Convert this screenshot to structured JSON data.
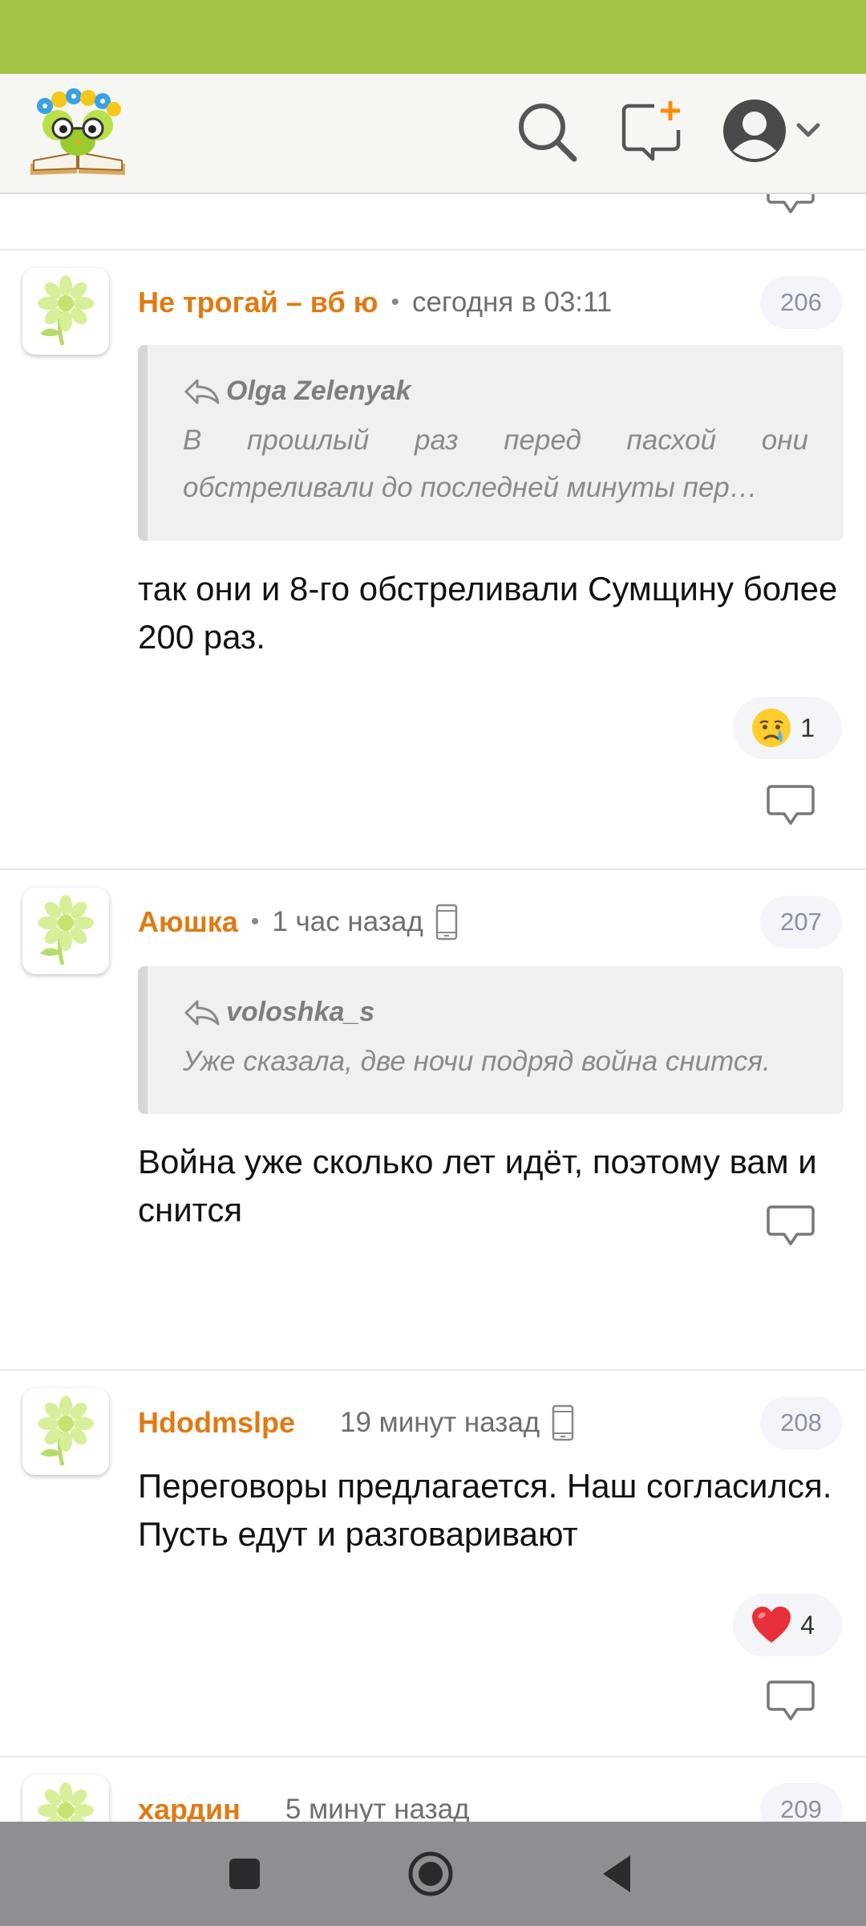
{
  "colors": {
    "status_bar": "#9fc345",
    "author": "#e07a12",
    "accent": "#ff8a00"
  },
  "header": {
    "logo": "book-owl-logo",
    "icons": [
      "search-icon",
      "new-post-icon",
      "profile-avatar-icon",
      "chevron-down-icon"
    ]
  },
  "comments": [
    {
      "author": "Не трогай – вб ю",
      "time": "сегодня в 03:11",
      "number": "206",
      "quote": {
        "author": "Olga Zelenyak",
        "line1": "В прошлый раз перед пасхой они",
        "line2": "обстреливали до последней минуты пер…"
      },
      "text": "так они и 8-го обстреливали Сумщину более 200 раз.",
      "reaction": {
        "icon": "crying-face-emoji",
        "count": "1"
      }
    },
    {
      "author": "Аюшка",
      "time": "1 час назад",
      "number": "207",
      "quote": {
        "author": "voloshka_s",
        "text": "Уже сказала, две ночи подряд война снится."
      },
      "text": "Война уже сколько лет идёт, поэтому вам и снится"
    },
    {
      "author": "Hdodmslpe",
      "time": "19 минут назад",
      "number": "208",
      "text": "Переговоры предлагается. Наш согласился. Пусть едут и разговаривают",
      "reaction": {
        "icon": "red-heart-emoji",
        "count": "4"
      }
    },
    {
      "author": "хардин",
      "time": "5 минут назад",
      "number": "209"
    }
  ],
  "navbar": {
    "icons": [
      "recent-apps-icon",
      "home-icon",
      "back-icon"
    ]
  }
}
